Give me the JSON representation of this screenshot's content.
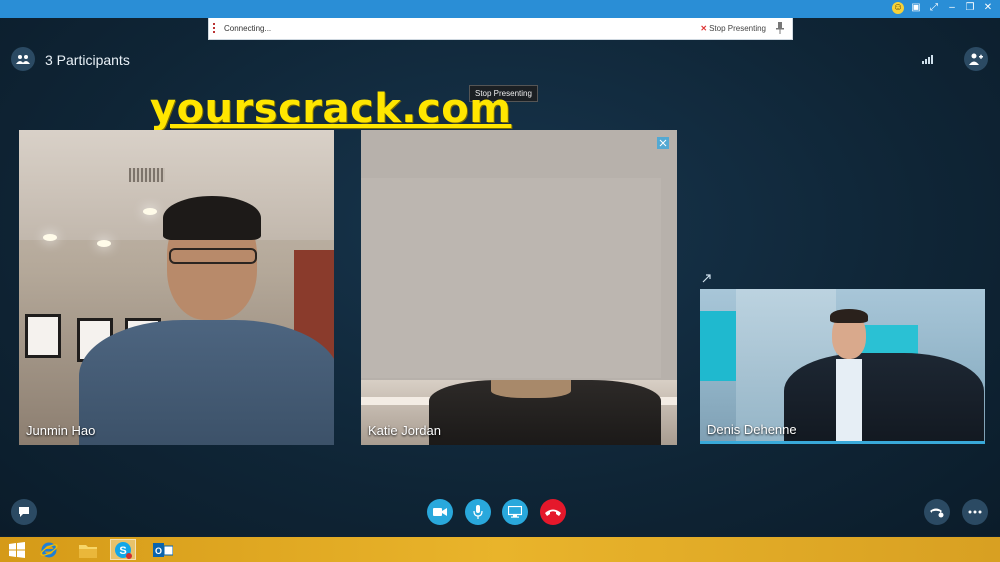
{
  "presenting_bar": {
    "status": "Connecting...",
    "stop_label": "Stop Presenting"
  },
  "header": {
    "participants_label": "3 Participants"
  },
  "tooltip": "Stop Presenting",
  "watermark": "yourscrack.com",
  "tiles": [
    {
      "name": "Junmin Hao"
    },
    {
      "name": "Katie Jordan"
    },
    {
      "name": "Denis Dehenne"
    }
  ],
  "controls": {
    "camera": "video-camera-icon",
    "mic": "microphone-icon",
    "share": "screen-share-icon",
    "hangup": "hang-up-icon"
  },
  "colors": {
    "accent": "#29a8dc",
    "hangup": "#e5182b",
    "watermark": "#ffe600",
    "taskbar": "#e9b42b"
  },
  "taskbar": {
    "items": [
      "windows-start-icon",
      "internet-explorer-icon",
      "file-explorer-icon",
      "skype-icon",
      "outlook-icon"
    ]
  }
}
